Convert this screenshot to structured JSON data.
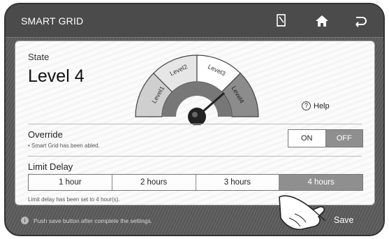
{
  "header": {
    "title": "SMART GRID",
    "icons": [
      "memo-icon",
      "home-icon",
      "back-icon"
    ]
  },
  "state": {
    "label": "State",
    "value": "Level 4"
  },
  "gauge": {
    "levels": [
      "Level1",
      "Level2",
      "Level3",
      "Level4"
    ],
    "current_level": 4
  },
  "help": {
    "icon_glyph": "?",
    "label": "Help"
  },
  "override": {
    "label": "Override",
    "note": "• Smart Grid has been abled.",
    "on_label": "ON",
    "off_label": "OFF",
    "selected": "OFF"
  },
  "limit_delay": {
    "label": "Limit Delay",
    "options": [
      "1 hour",
      "2 hours",
      "3 hours",
      "4 hours"
    ],
    "selected": "4 hours",
    "note": "Limit delay has been set to 4 hour(s)."
  },
  "footer": {
    "info_glyph": "i",
    "message": "Push save button after complete the settings.",
    "save_label": "Save"
  },
  "colors": {
    "header_bg": "#4b4b4b",
    "panel_bg": "#fbfbfb",
    "selected_bg": "#8f8f8f",
    "gauge_level1": "#cfcfcf",
    "gauge_level2": "#e6e6e6",
    "gauge_level3": "#ffffff",
    "gauge_level4": "#8c8c8c"
  }
}
